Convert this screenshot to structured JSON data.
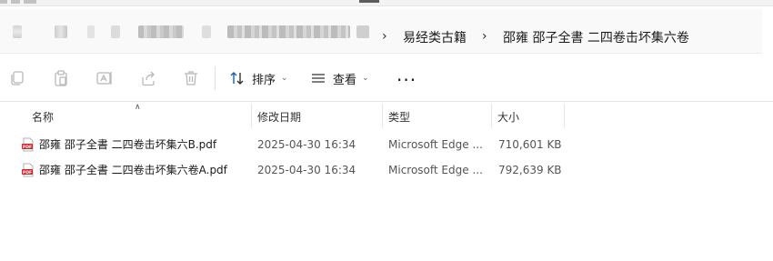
{
  "breadcrumb": {
    "items": [
      "易经类古籍",
      "邵雍 邵子全書 二四卷击坏集六卷"
    ]
  },
  "toolbar": {
    "sort_label": "排序",
    "view_label": "查看",
    "more_label": "···"
  },
  "columns": {
    "name": "名称",
    "modified": "修改日期",
    "type": "类型",
    "size": "大小"
  },
  "files": [
    {
      "name": "邵雍 邵子全書 二四卷击坏集六B.pdf",
      "modified": "2025-04-30 16:34",
      "type": "Microsoft Edge ...",
      "size": "710,601 KB",
      "icon": "pdf-file-icon"
    },
    {
      "name": "邵雍 邵子全書 二四卷击坏集六卷A.pdf",
      "modified": "2025-04-30 16:34",
      "type": "Microsoft Edge ...",
      "size": "792,639 KB",
      "icon": "pdf-file-icon"
    }
  ],
  "colors": {
    "pdf_red": "#c4262e",
    "toolbar_icon_disabled": "#b8b8b8",
    "sort_icon_blue": "#1a5fb4"
  }
}
